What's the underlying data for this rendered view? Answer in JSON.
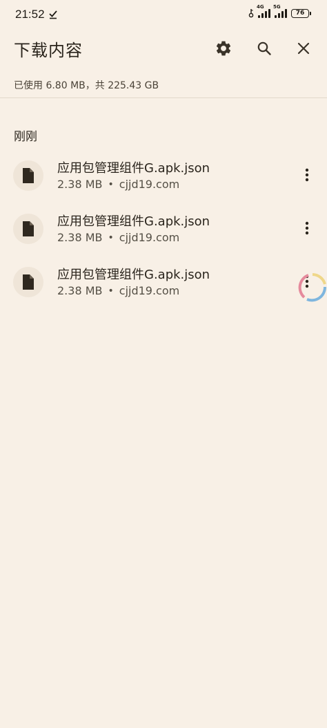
{
  "status_bar": {
    "time": "21:52",
    "network_1": "4G",
    "network_2": "5G",
    "battery": "76"
  },
  "header": {
    "title": "下载内容"
  },
  "storage": {
    "text": "已使用 6.80 MB，共 225.43 GB"
  },
  "section": {
    "label": "刚刚"
  },
  "downloads": [
    {
      "name": "应用包管理组件G.apk.json",
      "size": "2.38 MB",
      "separator": "•",
      "source": "cjjd19.com"
    },
    {
      "name": "应用包管理组件G.apk.json",
      "size": "2.38 MB",
      "separator": "•",
      "source": "cjjd19.com"
    },
    {
      "name": "应用包管理组件G.apk.json",
      "size": "2.38 MB",
      "separator": "•",
      "source": "cjjd19.com"
    }
  ],
  "colors": {
    "background": "#f8f0e6",
    "icon_circle": "#efe5d8",
    "text_primary": "#2a241c",
    "progress_blue": "#7fb6de",
    "progress_pink": "#e58a9c",
    "progress_yellow": "#efd789"
  },
  "icons": {
    "settings": "gear-icon",
    "search": "search-icon",
    "close": "close-icon",
    "file": "file-icon",
    "more": "more-vert-icon"
  }
}
